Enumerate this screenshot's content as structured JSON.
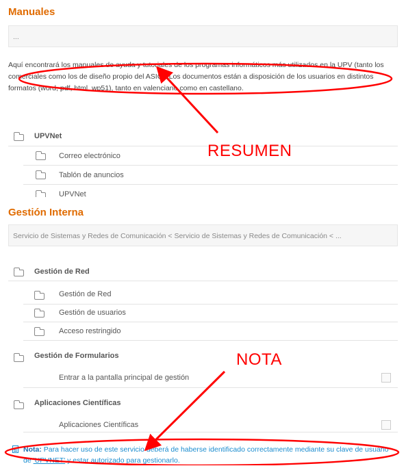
{
  "manuales": {
    "title": "Manuales",
    "breadcrumb": "...",
    "description": "Aquí encontrará los manuales de ayuda y tutoriales de los programas informáticos más utilizados en la UPV (tanto los comerciales como los de diseño propio del ASIC). Los documentos están a disposición de los usuarios en distintos formatos (word, pdf, html, wp51), tanto en valenciano como en castellano.",
    "group": "UPVNet",
    "items": [
      "Correo electrónico",
      "Tablón de anuncios",
      "UPVNet"
    ]
  },
  "annotations": {
    "resumen": "RESUMEN",
    "nota": "NOTA"
  },
  "gestion": {
    "title": "Gestión Interna",
    "breadcrumb": "Servicio de Sistemas y Redes de Comunicación < Servicio de Sistemas y Redes de Comunicación < ...",
    "group_red": "Gestión de Red",
    "red_items": [
      "Gestión de Red",
      "Gestión de usuarios",
      "Acceso restringido"
    ],
    "group_formularios": "Gestión de Formularios",
    "formularios_item": "Entrar a la pantalla principal de gestión",
    "group_aplicaciones": "Aplicaciones Científicas",
    "aplicaciones_item": "Aplicaciones Científicas"
  },
  "note": {
    "label": "Nota:",
    "text_before": " Para hacer uso de este servicio deberá de haberse identificado correctamente mediante su clave de usuario de ",
    "link": "'UPVNET'",
    "text_after": " y estar autorizado para gestionarlo."
  },
  "colors": {
    "section_title": "#e06b00",
    "annotation": "#ff0000",
    "note": "#1a8ccf"
  }
}
